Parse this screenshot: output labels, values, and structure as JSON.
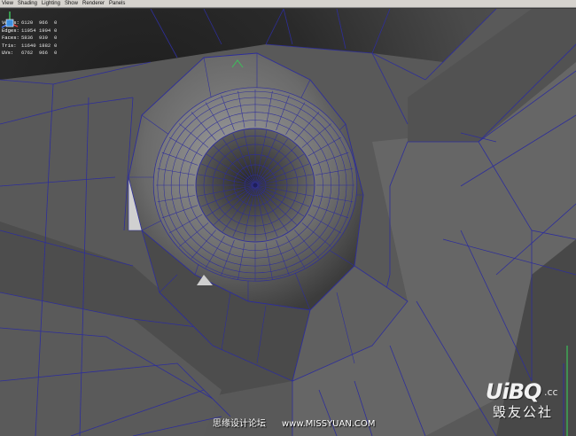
{
  "menubar": {
    "items": [
      "View",
      "Shading",
      "Lighting",
      "Show",
      "Renderer",
      "Panels"
    ]
  },
  "hud": {
    "rows": [
      {
        "label": "Verts:",
        "v1": "6120",
        "v2": "966",
        "v3": "0"
      },
      {
        "label": "Edges:",
        "v1": "11954",
        "v2": "1904",
        "v3": "0"
      },
      {
        "label": "Faces:",
        "v1": "5836",
        "v2": "939",
        "v3": "0"
      },
      {
        "label": "Tris:",
        "v1": "11640",
        "v2": "1882",
        "v3": "0"
      },
      {
        "label": "UVs:",
        "v1": "6762",
        "v2": "966",
        "v3": "0"
      }
    ]
  },
  "colors": {
    "wireframe": "#2e2e9a",
    "menubar_bg": "#d6d3ce",
    "hud_text": "#e6e6e6"
  },
  "watermark": {
    "logo": "UiBQ",
    "domain": ".cc",
    "cn_name": "毁友公社"
  },
  "credit": {
    "site_name": "思缘设计论坛",
    "url": "www.MISSYUAN.COM"
  }
}
